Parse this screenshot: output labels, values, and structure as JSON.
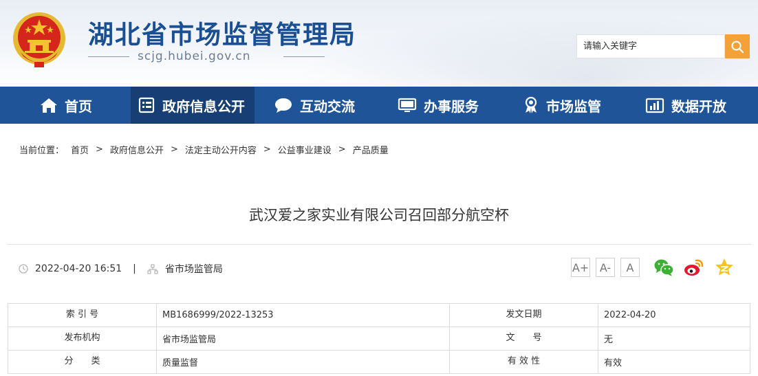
{
  "header": {
    "site_title": "湖北省市场监督管理局",
    "site_domain": "scjg.hubei.gov.cn",
    "search": {
      "placeholder": "请输入关键字"
    }
  },
  "nav": {
    "items": [
      {
        "label": "首页",
        "icon": "home-icon"
      },
      {
        "label": "政府信息公开",
        "icon": "document-list-icon",
        "active": true
      },
      {
        "label": "互动交流",
        "icon": "chat-bubble-icon"
      },
      {
        "label": "办事服务",
        "icon": "monitor-icon"
      },
      {
        "label": "市场监管",
        "icon": "award-badge-icon"
      },
      {
        "label": "数据开放",
        "icon": "bar-chart-icon"
      }
    ]
  },
  "breadcrumb": {
    "prefix": "当前位置：",
    "items": [
      "首页",
      "政府信息公开",
      "法定主动公开内容",
      "公益事业建设",
      "产品质量"
    ],
    "separator": ">"
  },
  "article": {
    "title": "武汉爱之家实业有限公司召回部分航空杯",
    "datetime": "2022-04-20 16:51",
    "divider": "|",
    "source": "省市场监管局",
    "font_controls": [
      "A+",
      "A-",
      "A"
    ],
    "share_icons": [
      "wechat-icon",
      "weibo-icon",
      "favorite-star-icon"
    ]
  },
  "info_table": {
    "rows": [
      {
        "label1": "索 引 号",
        "value1": "MB1686999/2022-13253",
        "label2": "发文日期",
        "value2": "2022-04-20"
      },
      {
        "label1": "发布机构",
        "value1": "省市场监管局",
        "label2": "文　　号",
        "value2": "无"
      },
      {
        "label1": "分　　类",
        "value1": "质量监督",
        "label2": "有 效 性",
        "value2": "有效"
      }
    ]
  },
  "colors": {
    "nav_bg": "#1f5499",
    "nav_active_bg": "#173f75",
    "title_blue": "#1b4f93",
    "search_button": "#f3a23a",
    "emblem_red": "#d5261c",
    "emblem_gold": "#f4c430"
  }
}
